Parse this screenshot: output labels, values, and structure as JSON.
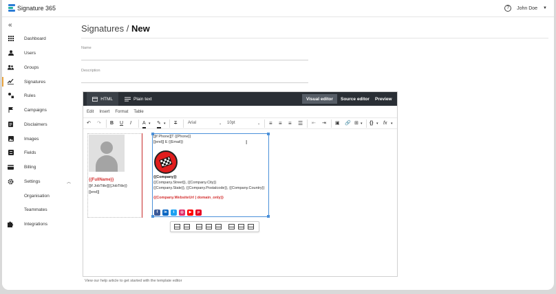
{
  "app": {
    "name": "Signature 365"
  },
  "header": {
    "user_name": "John Doe"
  },
  "sidebar": {
    "items": [
      {
        "label": "Dashboard",
        "icon": "grid-icon"
      },
      {
        "label": "Users",
        "icon": "person-icon"
      },
      {
        "label": "Groups",
        "icon": "group-icon"
      },
      {
        "label": "Signatures",
        "icon": "signature-icon",
        "active": true
      },
      {
        "label": "Rules",
        "icon": "rules-icon"
      },
      {
        "label": "Campaigns",
        "icon": "flag-icon"
      },
      {
        "label": "Disclaimers",
        "icon": "document-icon"
      },
      {
        "label": "Images",
        "icon": "image-icon"
      },
      {
        "label": "Fields",
        "icon": "fields-icon"
      },
      {
        "label": "Billing",
        "icon": "card-icon"
      },
      {
        "label": "Settings",
        "icon": "gear-icon",
        "expanded": true
      },
      {
        "label": "Organisation",
        "sub": true
      },
      {
        "label": "Teammates",
        "sub": true
      },
      {
        "label": "Integrations",
        "icon": "puzzle-icon"
      }
    ]
  },
  "page": {
    "breadcrumb": "Signatures",
    "separator": "/",
    "current": "New",
    "name_label": "Name",
    "name_value": "",
    "description_label": "Description",
    "description_value": ""
  },
  "editor": {
    "tabs": {
      "html": "HTML",
      "plain": "Plain text"
    },
    "modes": {
      "visual": "Visual editor",
      "source": "Source editor",
      "preview": "Preview"
    },
    "menu": [
      "Edit",
      "Insert",
      "Format",
      "Table"
    ],
    "font": "Arial",
    "size": "10pt",
    "help_text": "View our help article to get started with the template editor"
  },
  "signature": {
    "full_name": "{{FullName}}",
    "job_title": "[[if JobTitle]]{{JobTitle}}",
    "end1": "[[end]]",
    "phone": "[[if Phone]]T {{Phone}}",
    "end_email": "[[end]] E {{Email}}",
    "company": "{{Company}}",
    "address1": "{{Company.Street}}, {{Company.City}}",
    "address2": "{{Company.State}}, {{Company.Postalcode}}, {{Company.Country}}",
    "website": "{{Company.WebsiteUrl | domain_only}}"
  },
  "socials": [
    {
      "name": "facebook",
      "glyph": "f",
      "color": "#3b5998"
    },
    {
      "name": "linkedin",
      "glyph": "in",
      "color": "#0a66c2"
    },
    {
      "name": "twitter",
      "glyph": "t",
      "color": "#1da1f2"
    },
    {
      "name": "instagram",
      "glyph": "◎",
      "color": "#e1306c"
    },
    {
      "name": "youtube",
      "glyph": "▶",
      "color": "#ff0000"
    },
    {
      "name": "pinterest",
      "glyph": "p",
      "color": "#e60023"
    }
  ],
  "colors": {
    "accent": "#e8a33d",
    "editor_bar": "#2a2f35",
    "name_red": "#d32f2f",
    "selection": "#4a90d9"
  }
}
